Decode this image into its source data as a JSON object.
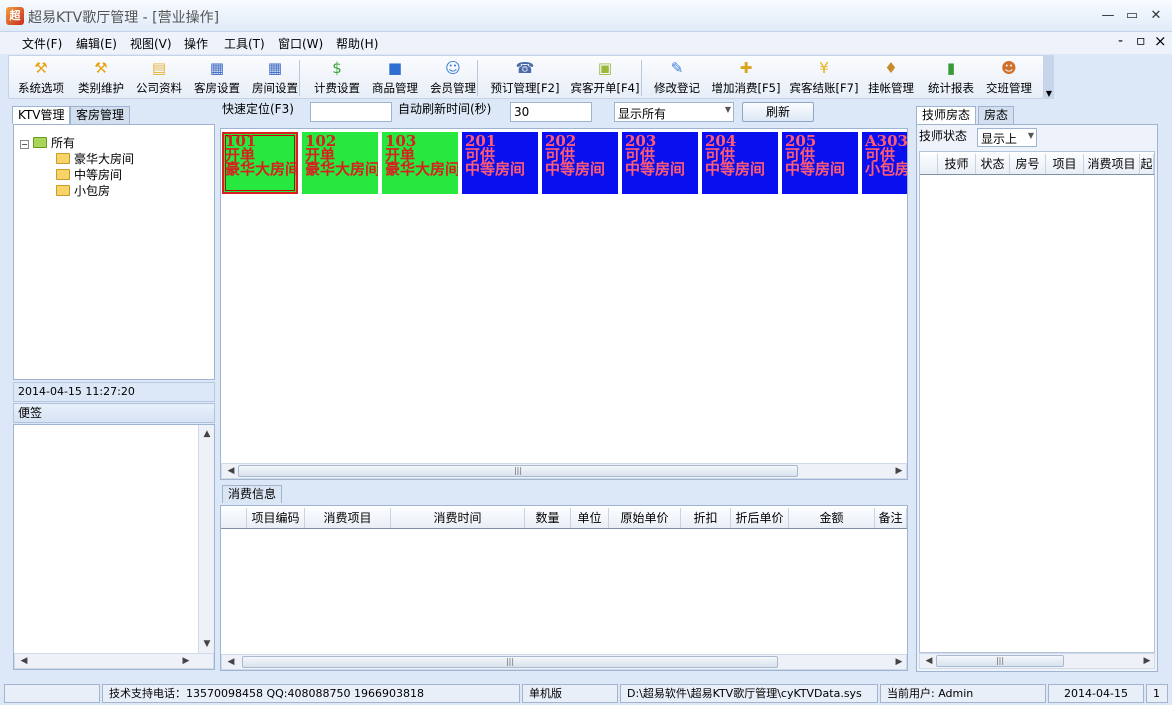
{
  "window": {
    "app_icon": "超",
    "title": "超易KTV歌厅管理 - [营业操作]",
    "minimize": "—",
    "maximize": "▭",
    "close": "✕",
    "mdi_min": "-",
    "mdi_restore": "▫",
    "mdi_close": "×"
  },
  "menu": [
    "文件(F)",
    "编辑(E)",
    "视图(V)",
    "操作",
    "工具(T)",
    "窗口(W)",
    "帮助(H)"
  ],
  "toolbar": [
    {
      "label": "系统选项",
      "icon": "hammer-icon",
      "glyph": "⚒",
      "color": "#e8a317"
    },
    {
      "label": "类别维护",
      "icon": "hammer-icon",
      "glyph": "⚒",
      "color": "#e8a317"
    },
    {
      "label": "公司资料",
      "icon": "book-icon",
      "glyph": "▤",
      "color": "#e6b233"
    },
    {
      "label": "客房设置",
      "icon": "building-icon",
      "glyph": "▦",
      "color": "#3a68c4"
    },
    {
      "label": "房间设置",
      "icon": "building-icon",
      "glyph": "▦",
      "color": "#3a68c4"
    },
    {
      "label": "计费设置",
      "icon": "money-icon",
      "glyph": "$",
      "color": "#3aa03a"
    },
    {
      "label": "商品管理",
      "icon": "box-icon",
      "glyph": "■",
      "color": "#2e6fd1"
    },
    {
      "label": "会员管理",
      "icon": "person-icon",
      "glyph": "☺",
      "color": "#3a7fd6"
    },
    {
      "label": "预订管理[F2]",
      "icon": "phone-icon",
      "glyph": "☎",
      "color": "#4a6aa8"
    },
    {
      "label": "宾客开单[F4]",
      "icon": "package-icon",
      "glyph": "▣",
      "color": "#9bb83a"
    },
    {
      "label": "修改登记",
      "icon": "user-edit-icon",
      "glyph": "✎",
      "color": "#3a7fd6"
    },
    {
      "label": "增加消费[F5]",
      "icon": "add-coin-icon",
      "glyph": "✚",
      "color": "#d9a520"
    },
    {
      "label": "宾客结账[F7]",
      "icon": "yen-coin-icon",
      "glyph": "¥",
      "color": "#e2b217"
    },
    {
      "label": "挂帐管理",
      "icon": "money-bag-icon",
      "glyph": "♦",
      "color": "#c98c2a"
    },
    {
      "label": "统计报表",
      "icon": "bar-chart-icon",
      "glyph": "▮",
      "color": "#3a9a3a"
    },
    {
      "label": "交班管理",
      "icon": "users-icon",
      "glyph": "☻",
      "color": "#d0702a"
    }
  ],
  "left_tabs": [
    "KTV管理",
    "客房管理"
  ],
  "tree": {
    "root": "所有",
    "children": [
      "豪华大房间",
      "中等房间",
      "小包房"
    ]
  },
  "datetime": "2014-04-15 11:27:20",
  "memo_label": "便签",
  "quick_locate_label": "快速定位(F3)",
  "quick_locate_value": "",
  "refresh_label": "自动刷新时间(秒)",
  "refresh_value": "30",
  "filter_value": "显示所有",
  "refresh_button": "刷新",
  "rooms": [
    {
      "no": "101",
      "status": "开单",
      "type": "豪华大房间",
      "color": "green",
      "selected": true
    },
    {
      "no": "102",
      "status": "开单",
      "type": "豪华大房间",
      "color": "green",
      "selected": false
    },
    {
      "no": "103",
      "status": "开单",
      "type": "豪华大房间",
      "color": "green",
      "selected": false
    },
    {
      "no": "201",
      "status": "可供",
      "type": "中等房间",
      "color": "blue",
      "selected": false
    },
    {
      "no": "202",
      "status": "可供",
      "type": "中等房间",
      "color": "blue",
      "selected": false
    },
    {
      "no": "203",
      "status": "可供",
      "type": "中等房间",
      "color": "blue",
      "selected": false
    },
    {
      "no": "204",
      "status": "可供",
      "type": "中等房间",
      "color": "blue",
      "selected": false
    },
    {
      "no": "205",
      "status": "可供",
      "type": "中等房间",
      "color": "blue",
      "selected": false
    },
    {
      "no": "A303",
      "status": "可供",
      "type": "小包房",
      "color": "blue",
      "selected": false
    }
  ],
  "consumption_tab": "消费信息",
  "consumption_columns": [
    "",
    "项目编码",
    "消费项目",
    "消费时间",
    "数量",
    "单位",
    "原始单价",
    "折扣",
    "折后单价",
    "金额",
    "备注"
  ],
  "right_tabs": [
    "技师房态",
    "房态"
  ],
  "tech_status_label": "技师状态",
  "tech_status_value": "显示上",
  "tech_columns": [
    "",
    "技师",
    "状态",
    "房号",
    "项目",
    "消费项目",
    "起"
  ],
  "statusbar": [
    "",
    "技术支持电话：13570098458 QQ:408088750 1966903818",
    "单机版",
    "D:\\超易软件\\超易KTV歌厅管理\\cyKTVData.sys",
    "当前用户: Admin",
    "2014-04-15",
    "1"
  ],
  "scroll_grip": "|||"
}
